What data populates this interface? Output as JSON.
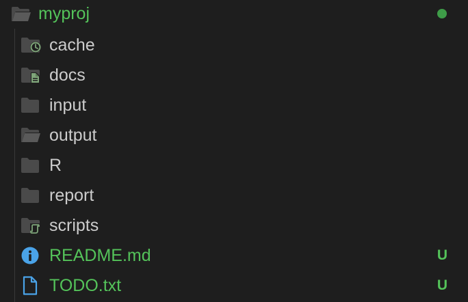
{
  "explorer": {
    "root": {
      "name": "myproj",
      "icon": "folder-open-icon",
      "status": "modified-dot",
      "status_color": "#3e9c48"
    },
    "items": [
      {
        "name": "cache",
        "icon": "folder-clock-icon",
        "type": "folder",
        "git": ""
      },
      {
        "name": "docs",
        "icon": "folder-docs-icon",
        "type": "folder",
        "git": ""
      },
      {
        "name": "input",
        "icon": "folder-icon",
        "type": "folder",
        "git": ""
      },
      {
        "name": "output",
        "icon": "folder-open-icon",
        "type": "folder",
        "git": ""
      },
      {
        "name": "R",
        "icon": "folder-icon",
        "type": "folder",
        "git": ""
      },
      {
        "name": "report",
        "icon": "folder-icon",
        "type": "folder",
        "git": ""
      },
      {
        "name": "scripts",
        "icon": "folder-scripts-icon",
        "type": "folder",
        "git": ""
      },
      {
        "name": "README.md",
        "icon": "info-icon",
        "type": "file",
        "git": "U"
      },
      {
        "name": "TODO.txt",
        "icon": "file-icon",
        "type": "file",
        "git": "U"
      }
    ],
    "colors": {
      "background": "#1e1e1e",
      "text": "#cccccc",
      "untracked": "#54c35a",
      "folder": "#4a4a4a",
      "info_blue": "#4aa3e8",
      "accent_green": "#7fa57a"
    }
  }
}
